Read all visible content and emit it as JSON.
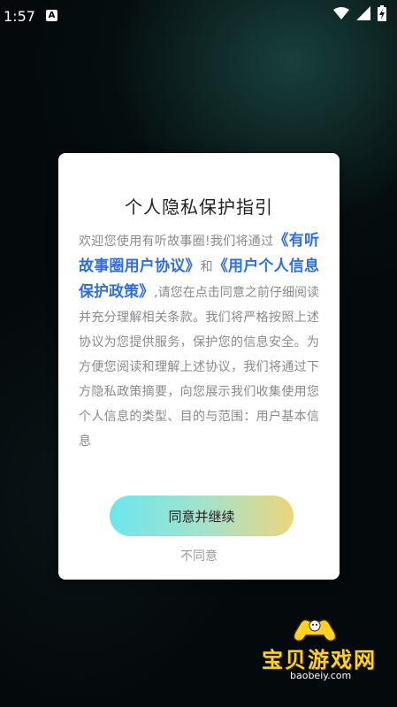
{
  "status_bar": {
    "time": "1:57",
    "notification_badge": "A",
    "icons": [
      "wifi-icon",
      "signal-icon",
      "battery-charging-icon"
    ]
  },
  "dialog": {
    "title": "个人隐私保护指引",
    "body": {
      "intro": "欢迎您使用有听故事圈!我们将通过",
      "link_user_agreement": "《有听故事圈用户协议》",
      "and": "和",
      "link_privacy_policy": "《用户个人信息保护政策》",
      "rest": ",请您在点击同意之前仔细阅读并充分理解相关条款。我们将严格按照上述协议为您提供服务，保护您的信息安全。为方便您阅读和理解上述协议，我们将通过下方隐私政策摘要，向您展示我们收集使用您个人信息的类型、目的与范围：用户基本信息"
    },
    "agree_label": "同意并继续",
    "disagree_label": "不同意"
  },
  "watermark": {
    "name": "宝贝游戏网",
    "url": "baobeiy.com"
  },
  "colors": {
    "link": "#2f6fd6",
    "button_gradient_start": "#6de6ee",
    "button_gradient_end": "#ecd57c",
    "watermark": "#ffd21f"
  }
}
